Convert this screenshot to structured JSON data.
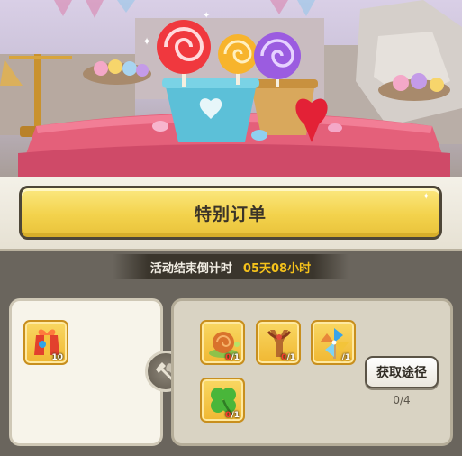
{
  "event": {
    "title": "特别订单",
    "countdown_label": "活动结束倒计时",
    "countdown_value": "05天08小时"
  },
  "reward": {
    "item": "gift-box-icon",
    "count": "10"
  },
  "requirements": [
    {
      "item": "snail-icon",
      "have": "0",
      "need": "/1"
    },
    {
      "item": "slingshot-icon",
      "have": "0",
      "need": "/1"
    },
    {
      "item": "pinwheel-icon",
      "have": "",
      "need": "/1"
    },
    {
      "item": "clover-icon",
      "have": "0",
      "need": "/1"
    }
  ],
  "get_button_label": "获取途径",
  "progress_text": "0/4",
  "colors": {
    "title_yellow": "#f3d24c",
    "countdown_value": "#f5c21b",
    "slot_gold": "#f0b732"
  }
}
